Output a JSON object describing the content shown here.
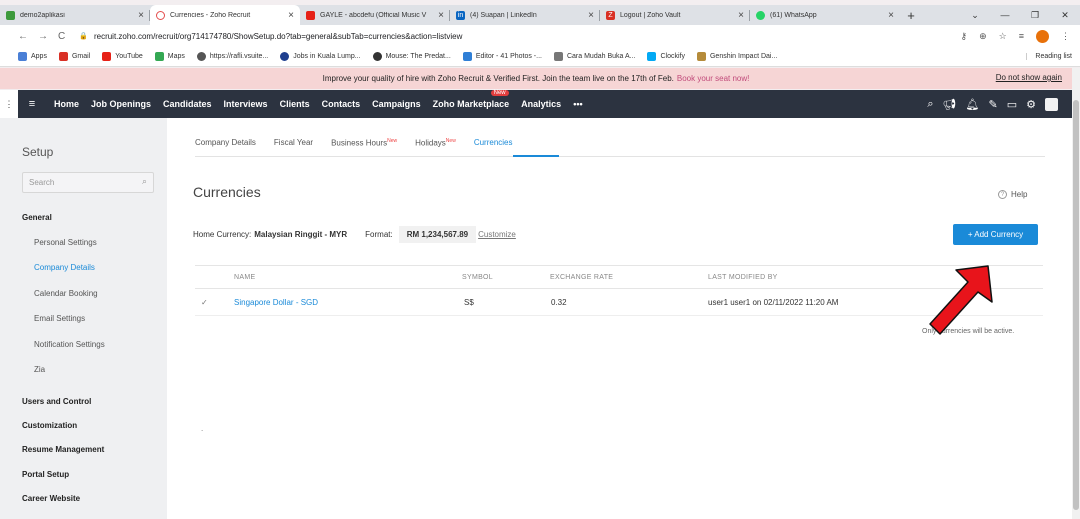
{
  "browser": {
    "tabs": [
      {
        "title": "demo2aplikasi",
        "icon_color": "#3c9a3c",
        "active": false
      },
      {
        "title": "Currencies - Zoho Recruit",
        "icon_color": "#e44d4d",
        "active": true
      },
      {
        "title": "GAYLE - abcdefu (Official Music V",
        "icon_color": "#e62117",
        "active": false
      },
      {
        "title": "(4) Suapan | LinkedIn",
        "icon_color": "#0a66c2",
        "active": false
      },
      {
        "title": "Logout | Zoho Vault",
        "icon_color": "#d93025",
        "active": false
      },
      {
        "title": "(61) WhatsApp",
        "icon_color": "#25d366",
        "active": false
      }
    ],
    "tab_close": "×",
    "new_tab": "+",
    "window_controls": [
      "⌄",
      "—",
      "❐",
      "✕"
    ],
    "url": "recruit.zoho.com/recruit/org714174780/ShowSetup.do?tab=general&subTab=currencies&action=listview",
    "nav_icons": [
      "←",
      "→",
      "C"
    ],
    "toolbar_icons": [
      "⊕",
      "☆",
      "≡"
    ],
    "bookmarks": [
      {
        "label": "Apps",
        "color": "#4a7fd6"
      },
      {
        "label": "Gmail",
        "color": "#d93025"
      },
      {
        "label": "YouTube",
        "color": "#e62117"
      },
      {
        "label": "Maps",
        "color": "#34a853"
      },
      {
        "label": "https://rafli.vsuite...",
        "color": "#555555"
      },
      {
        "label": "Jobs in Kuala Lump...",
        "color": "#1f3f8f"
      },
      {
        "label": "Mouse: The Predat...",
        "color": "#333333"
      },
      {
        "label": "Editor - 41 Photos -...",
        "color": "#2f7fd6"
      },
      {
        "label": "Cara Mudah Buka A...",
        "color": "#777777"
      },
      {
        "label": "Clockify",
        "color": "#03a9f4"
      },
      {
        "label": "Genshin Impact Dai...",
        "color": "#b58b3a"
      }
    ],
    "reading_list": "Reading list"
  },
  "promo": {
    "text": "Improve your quality of hire with Zoho Recruit & Verified First. Join the team live on the 17th of Feb.",
    "link": "Book your seat now!",
    "dismiss": "Do not show again"
  },
  "nav": {
    "items": [
      "Home",
      "Job Openings",
      "Candidates",
      "Interviews",
      "Clients",
      "Contacts",
      "Campaigns",
      "Zoho Marketplace",
      "Analytics",
      "•••"
    ],
    "new_badge": "New",
    "icons": [
      "search-icon",
      "megaphone-icon",
      "bell-icon",
      "compose-icon",
      "calendar-icon",
      "settings-icon"
    ]
  },
  "sidebar": {
    "title": "Setup",
    "search_placeholder": "Search",
    "sections": [
      {
        "label": "General",
        "sub": [
          "Personal Settings",
          "Company Details",
          "Calendar Booking",
          "Email Settings",
          "Notification Settings",
          "Zia"
        ]
      },
      {
        "label": "Users and Control"
      },
      {
        "label": "Customization"
      },
      {
        "label": "Resume Management"
      },
      {
        "label": "Portal Setup"
      },
      {
        "label": "Career Website"
      }
    ]
  },
  "main": {
    "tabs": [
      {
        "label": "Company Details",
        "new": ""
      },
      {
        "label": "Fiscal Year",
        "new": ""
      },
      {
        "label": "Business Hours",
        "new": "New"
      },
      {
        "label": "Holidays",
        "new": "New"
      },
      {
        "label": "Currencies",
        "new": ""
      }
    ],
    "heading": "Currencies",
    "help": "Help",
    "home_currency_label": "Home Currency:",
    "home_currency_value": "Malaysian Ringgit - MYR",
    "format_label": "Format:",
    "format_value": "RM 1,234,567.89",
    "customize": "Customize",
    "add_button": "+ Add Currency",
    "table": {
      "headers": [
        "NAME",
        "SYMBOL",
        "EXCHANGE RATE",
        "LAST MODIFIED BY"
      ],
      "rows": [
        {
          "check": "✓",
          "name": "Singapore Dollar - SGD",
          "symbol": "S$",
          "rate": "0.32",
          "modified": "user1 user1 on 02/11/2022 11:20 AM"
        }
      ]
    },
    "note": "Only    currencies will be active.",
    "dot": "."
  },
  "colors": {
    "accent": "#1a8ad8",
    "navbar": "#2c3340",
    "promo_bg": "#f6d5d5",
    "arrow": "#e8141b"
  }
}
